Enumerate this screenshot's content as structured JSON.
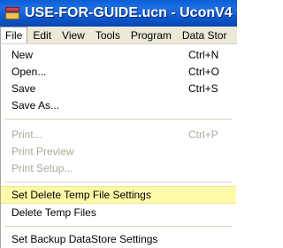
{
  "window": {
    "title": "USE-FOR-GUIDE.ucn - UconV4"
  },
  "menubar": {
    "items": [
      "File",
      "Edit",
      "View",
      "Tools",
      "Program",
      "Data Stor"
    ]
  },
  "file_menu": {
    "items": [
      {
        "label": "New",
        "shortcut": "Ctrl+N"
      },
      {
        "label": "Open...",
        "shortcut": "Ctrl+O"
      },
      {
        "label": "Save",
        "shortcut": "Ctrl+S"
      },
      {
        "label": "Save As...",
        "shortcut": ""
      },
      {
        "label": "Print...",
        "shortcut": "Ctrl+P"
      },
      {
        "label": "Print Preview",
        "shortcut": ""
      },
      {
        "label": "Print Setup...",
        "shortcut": ""
      },
      {
        "label": "Set Delete Temp File Settings",
        "shortcut": ""
      },
      {
        "label": "Delete Temp Files",
        "shortcut": ""
      },
      {
        "label": "Set Backup DataStore Settings",
        "shortcut": ""
      }
    ]
  },
  "colors": {
    "titlebar": "#0a5ed6",
    "highlight": "#fffaa8",
    "disabled_text": "#aca899"
  }
}
